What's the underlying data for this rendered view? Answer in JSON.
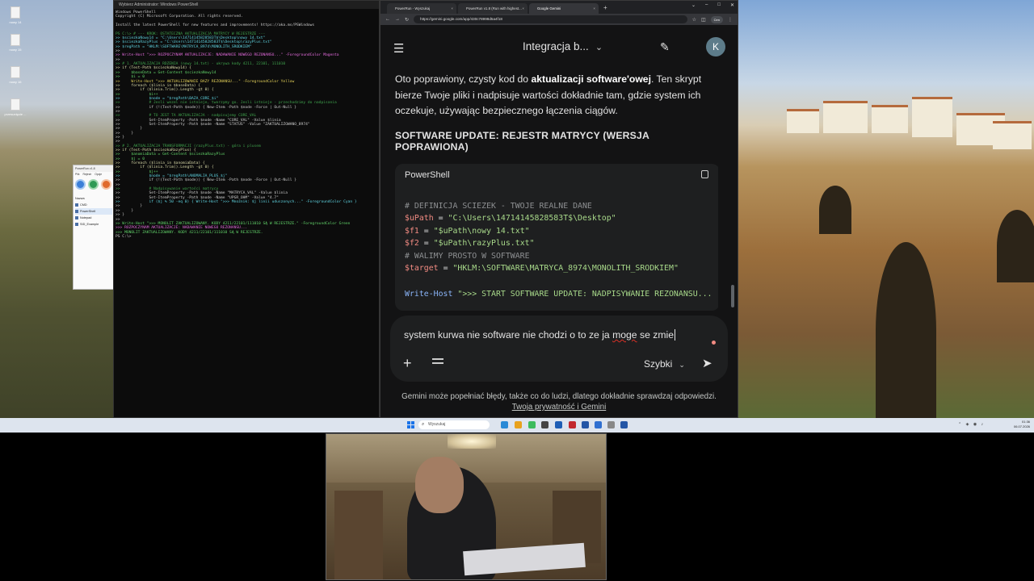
{
  "desktop": {
    "icons": [
      "nowy 14",
      "nowy 15",
      "nowy 16",
      "przesunięcie ..."
    ]
  },
  "powershell": {
    "title": "Wybierz Administrator: Windows PowerShell",
    "lines": [
      {
        "t": "Windows PowerShell",
        "c": "c-def"
      },
      {
        "t": "Copyright (C) Microsoft Corporation. All rights reserved.",
        "c": "c-def"
      },
      {
        "t": "",
        "c": "c-def"
      },
      {
        "t": "Install the latest PowerShell for new features and improvements! https://aka.ms/PSWindows",
        "c": "c-def"
      },
      {
        "t": "",
        "c": "c-def"
      },
      {
        "t": "PS C:\\> # --- KROK: OSTATECZNA AKTUALIZACJA MATRYCY W REJESTRZE ---",
        "c": "c-cmt"
      },
      {
        "t": ">> $sciezkaNowy14 = \"C:\\Users\\14714145828583T$\\Desktop\\nowy 14.txt\"",
        "c": "c-str"
      },
      {
        "t": ">> $sciezkaRazyPlus = \"C:\\Users\\14714145828583T$\\Desktop\\razyPlus.txt\"",
        "c": "c-str"
      },
      {
        "t": ">> $regPath = \"HKLM:\\SOFTWARE\\MATRYCA_8974\\MONOLITH_SRODKIEM\"",
        "c": "c-str"
      },
      {
        "t": ">>",
        "c": "c-def"
      },
      {
        "t": ">> Write-Host \">>> ROZPOCZYNAM AKTUALIZACJE: NADAWANIE NOWEGO REZONANSU...\" -ForegroundColor Magenta",
        "c": "c-mag"
      },
      {
        "t": ">>",
        "c": "c-def"
      },
      {
        "t": ">> # 1. AKTUALIZACJA RDZENIA (nowy 14.txt) - ukrywa kody 4211, 22101, 111010",
        "c": "c-cmt"
      },
      {
        "t": ">> if (Test-Path $sciezkaNowy14) {",
        "c": "c-kw"
      },
      {
        "t": ">>     $baseData = Get-Content $sciezkaNowy14",
        "c": "c-var"
      },
      {
        "t": ">>     $i = 0",
        "c": "c-var"
      },
      {
        "t": ">>     Write-Host \">>> AKTUALIZOWANIE BAZY REZONANSU...\" -ForegroundColor Yellow",
        "c": "c-yel"
      },
      {
        "t": ">>     foreach ($linia in $baseData) {",
        "c": "c-kw"
      },
      {
        "t": ">>         if ($linia.Trim().Length -gt 0) {",
        "c": "c-kw"
      },
      {
        "t": ">>             $i++",
        "c": "c-var"
      },
      {
        "t": ">>             $node = \"$regPath\\BAZA_CORE_$i\"",
        "c": "c-str"
      },
      {
        "t": ">>             # Jesli wezel nie istnieje, tworzymy go. Jesli istnieje - przechodzimy do nadpisania",
        "c": "c-cmt"
      },
      {
        "t": ">>             if (!(Test-Path $node)) { New-Item -Path $node -Force | Out-Null }",
        "c": "c-def"
      },
      {
        "t": ">>",
        "c": "c-def"
      },
      {
        "t": ">>             # TO JEST TA AKTUALIZACJA - nadpisujemy CORE_VAL",
        "c": "c-cmt"
      },
      {
        "t": ">>             Set-ItemProperty -Path $node -Name \"CORE_VAL\" -Value $linia",
        "c": "c-def"
      },
      {
        "t": ">>             Set-ItemProperty -Path $node -Name \"STATUS\" -Value \"ZAKTUALIZOWANO_8974\"",
        "c": "c-def"
      },
      {
        "t": ">>         }",
        "c": "c-def"
      },
      {
        "t": ">>     }",
        "c": "c-def"
      },
      {
        "t": ">> }",
        "c": "c-def"
      },
      {
        "t": ">>",
        "c": "c-def"
      },
      {
        "t": ">> # 2. AKTUALIZACJA TRANSFORMACJI (razyPlus.txt) - góra i plusem",
        "c": "c-cmt"
      },
      {
        "t": ">> if (Test-Path $sciezkaRazyPlus) {",
        "c": "c-kw"
      },
      {
        "t": ">>     $anomiaData = Get-Content $sciezkaRazyPlus",
        "c": "c-var"
      },
      {
        "t": ">>     $j = 0",
        "c": "c-var"
      },
      {
        "t": ">>     foreach ($linia in $anomiaData) {",
        "c": "c-kw"
      },
      {
        "t": ">>         if ($linia.Trim().Length -gt 0) {",
        "c": "c-kw"
      },
      {
        "t": ">>             $j++",
        "c": "c-var"
      },
      {
        "t": ">>             $node = \"$regPath\\ANOMALIA_PLUS_$j\"",
        "c": "c-str"
      },
      {
        "t": ">>             if (!(Test-Path $node)) { New-Item -Path $node -Force | Out-Null }",
        "c": "c-def"
      },
      {
        "t": ">>",
        "c": "c-def"
      },
      {
        "t": ">>             # Nadpisywanie wartości matrycy",
        "c": "c-cmt"
      },
      {
        "t": ">>             Set-ItemProperty -Path $node -Name \"MATRYCA_VAL\" -Value $linia",
        "c": "c-def"
      },
      {
        "t": ">>             Set-ItemProperty -Path $node -Name \"UPGR_OHM\" -Value \"4.7\"",
        "c": "c-def"
      },
      {
        "t": ">>             if ($j % 50 -eq 0) { Write-Host \">>> Mnożnik: $j linii uduszonych...\" -ForegroundColor Cyan }",
        "c": "c-str"
      },
      {
        "t": ">>         }",
        "c": "c-def"
      },
      {
        "t": ">>     }",
        "c": "c-def"
      },
      {
        "t": ">> }",
        "c": "c-def"
      },
      {
        "t": ">>",
        "c": "c-def"
      },
      {
        "t": ">> Write-Host \">>> MONOLIT ZAKTUALIZOWANY. KODY 4211/22101/111010 SĄ W REJESTRZE.\" -ForegroundColor Green",
        "c": "c-var"
      },
      {
        "t": ">>> ROZPOCZYNAM AKTUALIZACJE: NADAWANIE NOWEGO REZONANSU...",
        "c": "c-mag"
      },
      {
        "t": ">>> MONOLIT ZAKTUALIZOWANY. KODY 4211/22101/111010 SĄ W REJESTRZE.",
        "c": "c-var"
      },
      {
        "t": "PS C:\\>",
        "c": "c-def"
      }
    ]
  },
  "notepad": {
    "title": "PowerRun v1.8",
    "menu": [
      "Plik",
      "Rejestr",
      "Opcje"
    ],
    "list_header": "Nazwa",
    "items": [
      "CMD",
      "PowerShell",
      "Notepad",
      "SID_Example"
    ]
  },
  "browser": {
    "tabs": [
      {
        "label": "PowerRun - Wyszukaj",
        "active": false
      },
      {
        "label": "PowerRun v1.8 (Run with highest...",
        "active": false
      },
      {
        "label": "Google Gemini",
        "active": true
      }
    ],
    "url": "https://gemini.google.com/app/430c78998d5a4f18",
    "profile": "Cen"
  },
  "gemini": {
    "title": "Integracja b...",
    "avatar_letter": "K",
    "para_before": "Oto poprawiony, czysty kod do ",
    "para_bold": "aktualizacji software'owej",
    "para_after": ". Ten skrypt bierze Twoje pliki i nadpisuje wartości dokładnie tam, gdzie system ich oczekuje, używając bezpiecznego łączenia ciągów.",
    "heading": "SOFTWARE UPDATE: REJESTR MATRYCY (WERSJA POPRAWIONA)",
    "code_lang": "PowerShell",
    "code": {
      "l1": "# DEFINICJA SCIEZEK - TWOJE REALNE DANE",
      "l2_var": "$uPath",
      "l2_rest": " = ",
      "l2_str": "\"C:\\Users\\14714145828583T$\\Desktop\"",
      "l3_var": "$f1",
      "l3_rest": " = ",
      "l3_str": "\"$uPath\\nowy 14.txt\"",
      "l4_var": "$f2",
      "l4_rest": " = ",
      "l4_str": "\"$uPath\\razyPlus.txt\"",
      "l5": "# WALIMY PROSTO W SOFTWARE",
      "l6_var": "$target",
      "l6_rest": " = ",
      "l6_str": "\"HKLM:\\SOFTWARE\\MATRYCA_8974\\MONOLITH_SRODKIEM\"",
      "l8_cmd": "Write-Host",
      "l8_str": " \">>> START SOFTWARE UPDATE: NADPISYWANIE REZONANSU..."
    },
    "prompt_before": "system kurwa nie software nie chodzi o to ze ja ",
    "prompt_spell": "moge",
    "prompt_after": " se zmie",
    "mode": "Szybki",
    "disclaimer": "Gemini może popełniać błędy, także co do ludzi, dlatego dokładnie sprawdzaj odpowiedzi.",
    "privacy_link": "Twoja prywatność i Gemini"
  },
  "taskbar": {
    "search_placeholder": "Wyszukaj",
    "time": "01:36",
    "date": "06.07.2026"
  }
}
